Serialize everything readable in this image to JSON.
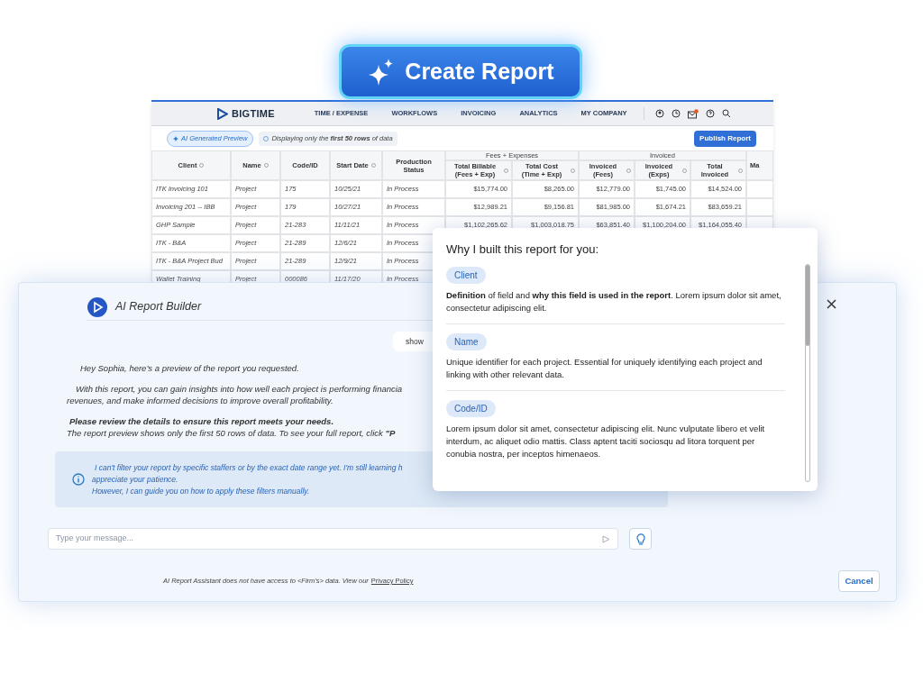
{
  "create_button": {
    "label": "Create Report"
  },
  "app": {
    "brand": "BIGTIME",
    "nav": [
      {
        "label": "TIME / EXPENSE"
      },
      {
        "label": "WORKFLOWS"
      },
      {
        "label": "INVOICING"
      },
      {
        "label": "ANALYTICS"
      },
      {
        "label": "MY COMPANY"
      }
    ],
    "badges": [
      {
        "kind": "ai",
        "text": "AI Generated Preview"
      },
      {
        "kind": "info",
        "text": "Displaying only the **first 50 rows** of data"
      }
    ],
    "publish_button": "Publish Report",
    "table": {
      "columns": [
        {
          "label": "Client",
          "sortable": true
        },
        {
          "label": "Name",
          "sortable": true
        },
        {
          "label": "Code/ID",
          "sortable": false
        },
        {
          "label": "Start Date",
          "sortable": true
        },
        {
          "label": "Production Status",
          "sortable": false
        }
      ],
      "column_groups": [
        {
          "label": "Fees + Expenses",
          "columns": [
            {
              "label": "Total Billable (Fees + Exp)",
              "sortable": true
            },
            {
              "label": "Total Cost (Time + Exp)",
              "sortable": true
            }
          ]
        },
        {
          "label": "Invoiced",
          "columns": [
            {
              "label": "Invoiced (Fees)",
              "sortable": true
            },
            {
              "label": "Invoiced (Exps)",
              "sortable": true
            },
            {
              "label": "Total Invoiced",
              "sortable": true
            }
          ]
        }
      ],
      "trailing_columns": [
        {
          "label": "Ma"
        }
      ],
      "rows": [
        {
          "cells": [
            "ITK Invoicing 101",
            "Project",
            "175",
            "10/25/21",
            "In Process",
            "$15,774.00",
            "$8,265.00",
            "$12,779.00",
            "$1,745.00",
            "$14,524.00"
          ]
        },
        {
          "cells": [
            "Invoicing 201 -- IBB",
            "Project",
            "179",
            "10/27/21",
            "In Process",
            "$12,989.21",
            "$9,156.81",
            "$81,985.00",
            "$1,674.21",
            "$83,659.21"
          ]
        },
        {
          "cells": [
            "GHP Sample",
            "Project",
            "21-283",
            "11/11/21",
            "In Process",
            "$1,102,265.62",
            "$1,003,018.75",
            "$63,851.40",
            "$1,100,204.00",
            "$1,164,055.40"
          ]
        },
        {
          "cells": [
            "ITK - B&A",
            "Project",
            "21-289",
            "12/6/21",
            "In Process"
          ]
        },
        {
          "cells": [
            "ITK - B&A Project Bud",
            "Project",
            "21-289",
            "12/9/21",
            "In Process"
          ]
        },
        {
          "cells": [
            "Wallet Training",
            "Project",
            "000086",
            "11/17/20",
            "In Process"
          ]
        }
      ]
    }
  },
  "builder": {
    "title": "AI Report Builder",
    "user_bubble": "show",
    "messages": [
      {
        "kind": "plain",
        "text": "Hey Sophia, here’s a preview of the report you requested."
      },
      {
        "kind": "plain",
        "text": "With this report, you can gain insights into how well each project is performing financia"
      },
      {
        "kind": "plain",
        "text": "revenues, and make informed decisions to improve overall profitability."
      },
      {
        "kind": "bold",
        "text": "Please review the details to ensure this report meets your needs."
      },
      {
        "kind": "plain",
        "text": "The report preview shows only the first 50 rows of data. To see your full report, click **\"P**"
      }
    ],
    "info": [
      "I can't filter your report by specific staffers or by the exact date range yet. I'm still learning h",
      "appreciate your patience.",
      "However, I can guide you on how to apply these filters manually."
    ],
    "input": {
      "placeholder": "Type your message..."
    },
    "footer": "AI Report Assistant does not have access to <Firm's> data. View our",
    "privacy_link": "Privacy Policy",
    "cancel_button": "Cancel"
  },
  "popup": {
    "title": "Why I built this report for you:",
    "fields": [
      {
        "tag": "Client",
        "text": "**Definition** of field and **why this field is used in the report**. Lorem ipsum dolor sit amet, consectetur adipiscing elit."
      },
      {
        "tag": "Name",
        "text": "Unique identifier for each project. Essential for uniquely identifying each project and linking with other relevant data."
      },
      {
        "tag": "Code/ID",
        "text": "Lorem ipsum dolor sit amet, consectetur adipiscing elit. Nunc vulputate libero et velit interdum, ac aliquet odio mattis. Class aptent taciti sociosqu ad litora torquent per conubia nostra, per inceptos himenaeos."
      }
    ]
  }
}
